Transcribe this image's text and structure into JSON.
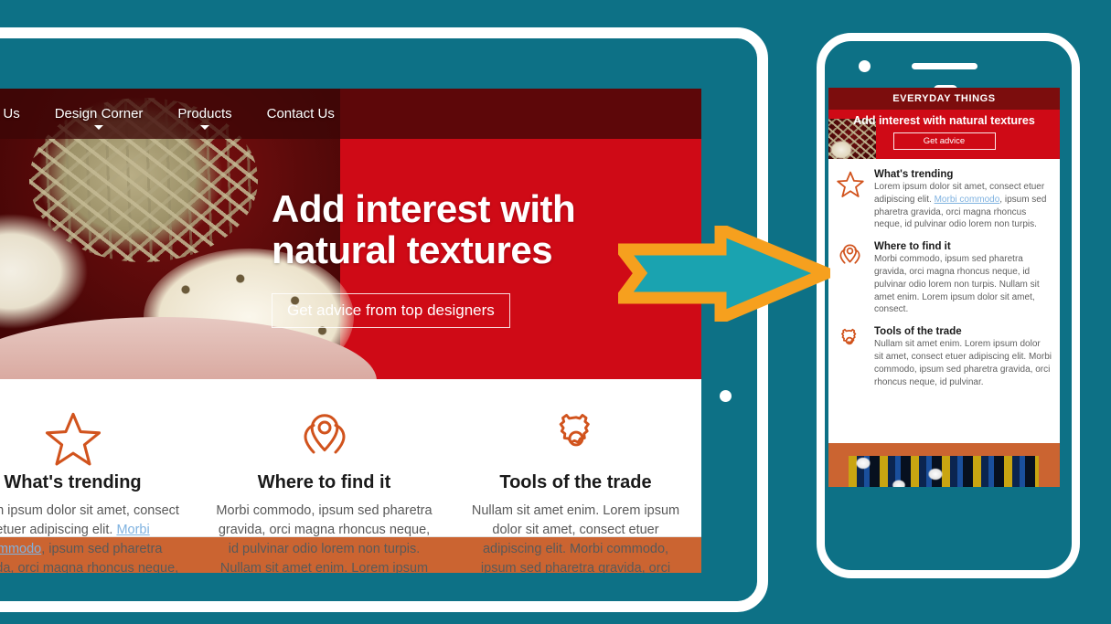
{
  "palette": {
    "background_teal": "#0d7186",
    "brand_red": "#cf0a16",
    "brand_dark_red": "#7c0d0d",
    "accent_orange": "#d1531d",
    "footer_orange": "#cb6431",
    "arrow_outline": "#f6a01e",
    "arrow_fill": "#1aa3b0",
    "link_blue": "#7fb2e0",
    "white": "#ffffff"
  },
  "tablet": {
    "nav": [
      {
        "label": "About Us",
        "has_caret": true
      },
      {
        "label": "Design Corner",
        "has_caret": true
      },
      {
        "label": "Products",
        "has_caret": true
      },
      {
        "label": "Contact Us",
        "has_caret": false
      }
    ],
    "hero": {
      "headline_line1": "Add interest with",
      "headline_line2": "natural textures",
      "cta_label": "Get advice from top designers"
    },
    "features": [
      {
        "icon": "star-icon",
        "title": "What's trending",
        "body_before": "Lorem ipsum dolor sit amet, consect etuer adipiscing elit. ",
        "link": "Morbi commodo",
        "body_after": ", ipsum sed pharetra gravida, orci magna rhoncus neque, id pulvinar odio lorem non turpis."
      },
      {
        "icon": "map-pin-icon",
        "title": "Where to find it",
        "body": "Morbi commodo, ipsum sed pharetra gravida, orci magna rhoncus neque, id pulvinar odio lorem non turpis. Nullam sit amet enim. Lorem ipsum dolor sit amet, consect."
      },
      {
        "icon": "gear-icon",
        "title": "Tools of the trade",
        "body": "Nullam sit amet enim. Lorem ipsum dolor sit amet, consect etuer adipiscing elit. Morbi commodo, ipsum sed pharetra gravida, orci rhoncus neque, id pulvinar odio."
      }
    ]
  },
  "phone": {
    "brand": "EVERYDAY THINGS",
    "hero": {
      "headline": "Add interest with natural textures",
      "cta_label": "Get advice"
    },
    "features": [
      {
        "icon": "star-icon",
        "title": "What's trending",
        "body_before": "Lorem ipsum dolor sit amet, consect etuer adipiscing elit. ",
        "link": "Morbi commodo",
        "body_after": ", ipsum sed pharetra gravida, orci magna rhoncus neque, id pulvinar odio lorem non turpis."
      },
      {
        "icon": "map-pin-icon",
        "title": "Where to find it",
        "body": "Morbi commodo, ipsum sed pharetra gravida, orci magna rhoncus neque, id pulvinar odio lorem non turpis. Nullam sit amet enim. Lorem ipsum dolor sit amet, consect."
      },
      {
        "icon": "gear-icon",
        "title": "Tools of the trade",
        "body": "Nullam sit amet enim. Lorem ipsum dolor sit amet, consect etuer adipiscing elit. Morbi commodo, ipsum sed pharetra gravida, orci rhoncus neque, id pulvinar."
      }
    ]
  }
}
